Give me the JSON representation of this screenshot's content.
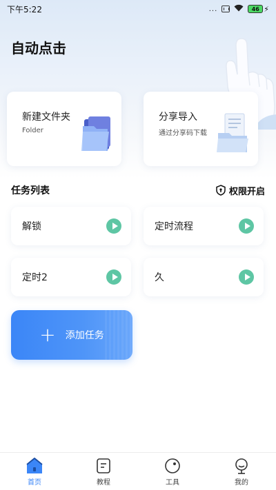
{
  "status_bar": {
    "time": "下午5:22",
    "dots": "...",
    "battery": "46"
  },
  "app": {
    "title": "自动点击"
  },
  "quick_cards": [
    {
      "title": "新建文件夹",
      "subtitle": "Folder"
    },
    {
      "title": "分享导入",
      "subtitle": "通过分享码下载"
    }
  ],
  "tasks_section": {
    "title": "任务列表",
    "permission_label": "权限开启"
  },
  "tasks": [
    {
      "label": "解锁"
    },
    {
      "label": "定时流程"
    },
    {
      "label": "定时2"
    },
    {
      "label": "久"
    }
  ],
  "add_task": {
    "label": "添加任务"
  },
  "tabbar": {
    "items": [
      {
        "label": "首页",
        "icon": "home-icon",
        "active": true
      },
      {
        "label": "教程",
        "icon": "tutorial-icon",
        "active": false
      },
      {
        "label": "工具",
        "icon": "tools-icon",
        "active": false
      },
      {
        "label": "我的",
        "icon": "profile-icon",
        "active": false
      }
    ]
  },
  "colors": {
    "accent": "#3b86f7",
    "play": "#5ec6a4"
  }
}
